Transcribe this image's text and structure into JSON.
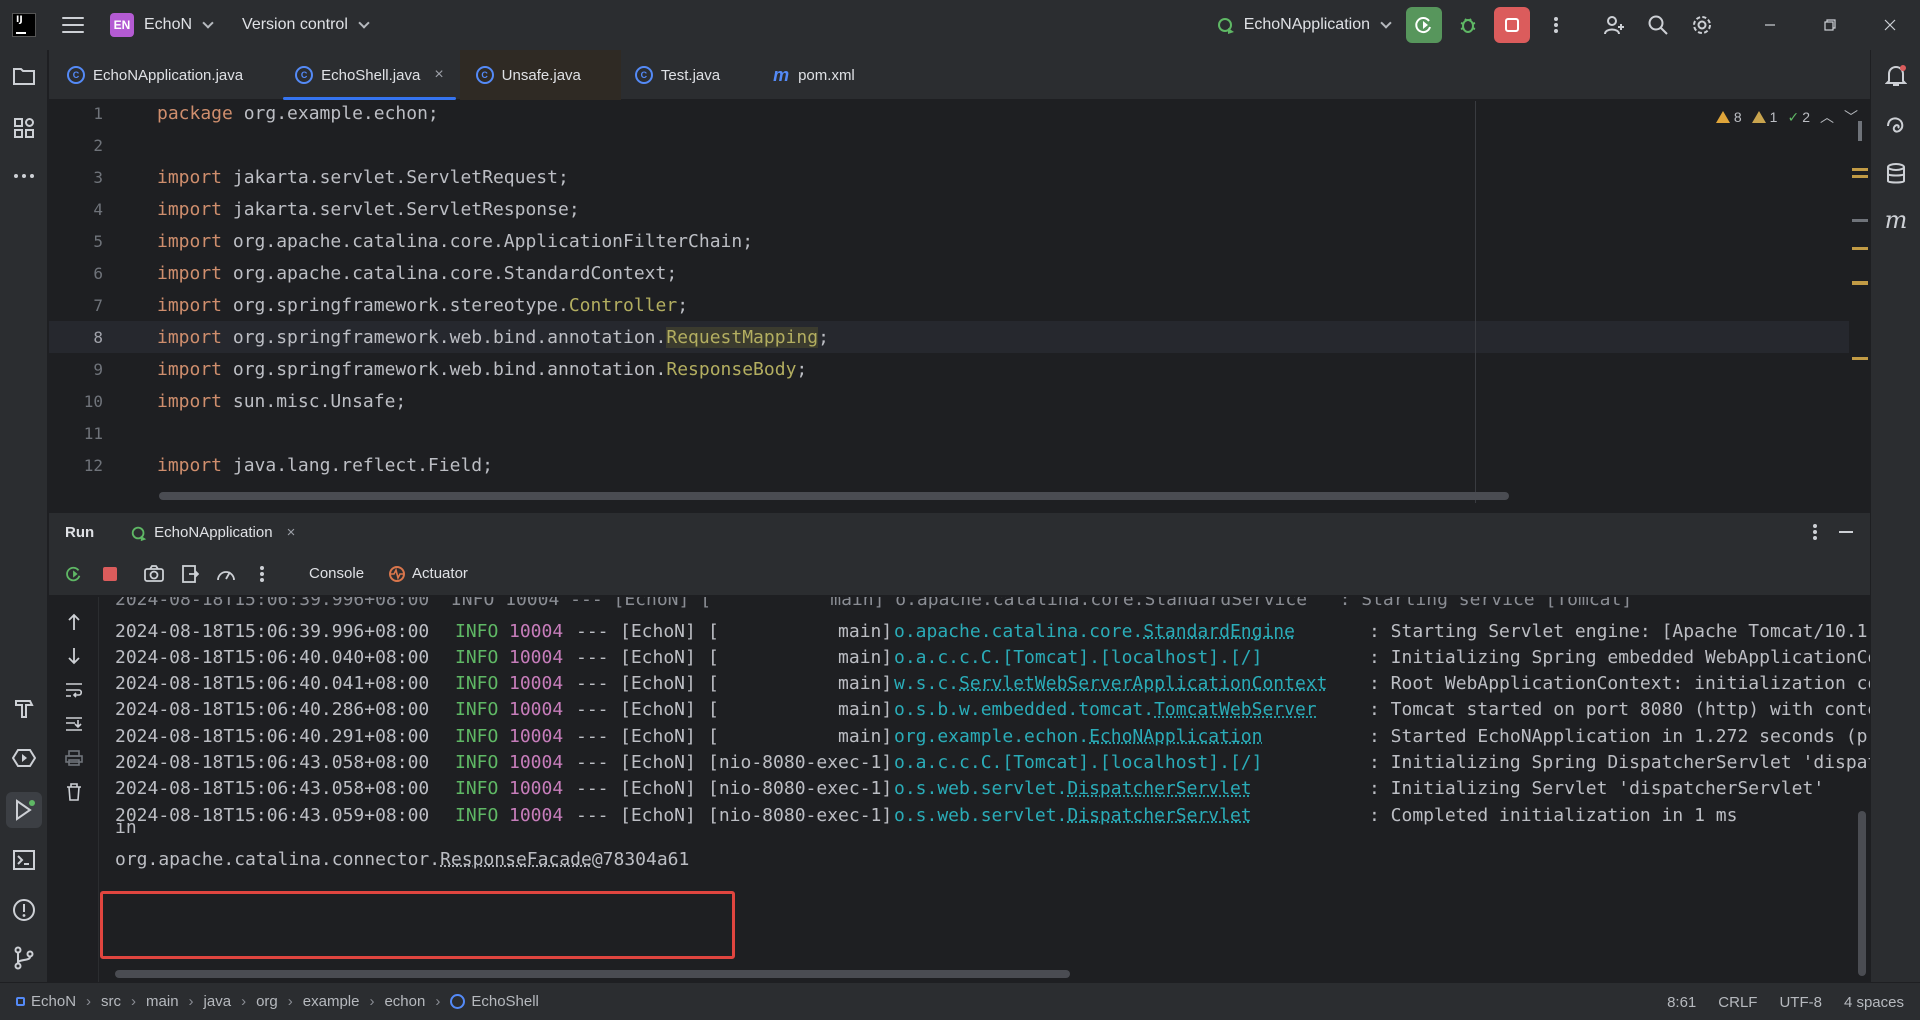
{
  "titlebar": {
    "project_badge": "EN",
    "project_name": "EchoN",
    "version_control": "Version control",
    "run_config": "EchoNApplication"
  },
  "tabs": [
    {
      "label": "EchoNApplication.java"
    },
    {
      "label": "EchoShell.java",
      "close": "×"
    },
    {
      "label": "Unsafe.java"
    },
    {
      "label": "Test.java"
    },
    {
      "label": "pom.xml"
    }
  ],
  "inspections": {
    "warnings": "8",
    "weak": "1",
    "ok": "2"
  },
  "editor": {
    "lines": [
      {
        "n": "1",
        "kw": "package",
        "rest": " org.example.echon;"
      },
      {
        "n": "2"
      },
      {
        "n": "3",
        "kw": "import",
        "rest": " jakarta.servlet.ServletRequest;"
      },
      {
        "n": "4",
        "kw": "import",
        "rest": " jakarta.servlet.ServletResponse;"
      },
      {
        "n": "5",
        "kw": "import",
        "rest": " org.apache.catalina.core.ApplicationFilterChain;"
      },
      {
        "n": "6",
        "kw": "import",
        "rest": " org.apache.catalina.core.StandardContext;"
      },
      {
        "n": "7",
        "kw": "import",
        "rest": " org.springframework.stereotype.",
        "ann": "Controller",
        "tail": ";"
      },
      {
        "n": "8",
        "kw": "import",
        "rest": " org.springframework.web.bind.annotation.",
        "ann": "RequestMapping",
        "tail": ";"
      },
      {
        "n": "9",
        "kw": "import",
        "rest": " org.springframework.web.bind.annotation.",
        "ann": "ResponseBody",
        "tail": ";"
      },
      {
        "n": "10",
        "kw": "import",
        "rest": " sun.misc.Unsafe;"
      },
      {
        "n": "11"
      },
      {
        "n": "12",
        "kw": "import",
        "rest": " java.lang.reflect.Field;"
      }
    ]
  },
  "run": {
    "title": "Run",
    "tab_label": "EchoNApplication",
    "tab_close": "×",
    "console_tab": "Console",
    "actuator_tab": "Actuator"
  },
  "console": {
    "logs": [
      {
        "ts": "2024-08-18T15:06:39.996+08:00",
        "lvl": "INFO",
        "pid": "10004",
        "sep": "---",
        "app": "[EchoN]",
        "thr": "[           main]",
        "lg_pre": "o.apache.catalina.core.",
        "lg_u": "StandardEngine",
        "msg": ": Starting Servlet engine: [Apache Tomcat/10.1."
      },
      {
        "ts": "2024-08-18T15:06:40.040+08:00",
        "lvl": "INFO",
        "pid": "10004",
        "sep": "---",
        "app": "[EchoN]",
        "thr": "[           main]",
        "lg_pre": "o.a.c.c.C.[Tomcat].[localhost].[/]",
        "lg_u": "",
        "msg": ": Initializing Spring embedded WebApplicationCo"
      },
      {
        "ts": "2024-08-18T15:06:40.041+08:00",
        "lvl": "INFO",
        "pid": "10004",
        "sep": "---",
        "app": "[EchoN]",
        "thr": "[           main]",
        "lg_pre": "w.s.c.",
        "lg_u": "ServletWebServerApplicationContext",
        "msg": ": Root WebApplicationContext: initialization co"
      },
      {
        "ts": "2024-08-18T15:06:40.286+08:00",
        "lvl": "INFO",
        "pid": "10004",
        "sep": "---",
        "app": "[EchoN]",
        "thr": "[           main]",
        "lg_pre": "o.s.b.w.embedded.tomcat.",
        "lg_u": "TomcatWebServer",
        "msg": ": Tomcat started on port 8080 (http) with conte"
      },
      {
        "ts": "2024-08-18T15:06:40.291+08:00",
        "lvl": "INFO",
        "pid": "10004",
        "sep": "---",
        "app": "[EchoN]",
        "thr": "[           main]",
        "lg_pre": "org.example.echon.",
        "lg_u": "EchoNApplication",
        "msg": ": Started EchoNApplication in 1.272 seconds (pr"
      },
      {
        "ts": "2024-08-18T15:06:43.058+08:00",
        "lvl": "INFO",
        "pid": "10004",
        "sep": "---",
        "app": "[EchoN]",
        "thr": "[nio-8080-exec-1]",
        "lg_pre": "o.a.c.c.C.[Tomcat].[localhost].[/]",
        "lg_u": "",
        "msg": ": Initializing Spring DispatcherServlet 'dispat"
      },
      {
        "ts": "2024-08-18T15:06:43.058+08:00",
        "lvl": "INFO",
        "pid": "10004",
        "sep": "---",
        "app": "[EchoN]",
        "thr": "[nio-8080-exec-1]",
        "lg_pre": "o.s.web.servlet.",
        "lg_u": "DispatcherServlet",
        "msg": ": Initializing Servlet 'dispatcherServlet'"
      },
      {
        "ts": "2024-08-18T15:06:43.059+08:00",
        "lvl": "INFO",
        "pid": "10004",
        "sep": "---",
        "app": "[EchoN]",
        "thr": "[nio-8080-exec-1]",
        "lg_pre": "o.s.web.servlet.",
        "lg_u": "DispatcherServlet",
        "msg": ": Completed initialization in 1 ms"
      }
    ],
    "partial_top": "2024-08-18T15:06:39.996+08:00  INFO 10004 --- [EchoN] [           main] o.apache.catalina.core.StandardService   : Starting service [Tomcat]",
    "plain_line": "in",
    "output_prefix": "org.apache.catalina.connector.",
    "output_class": "ResponseFacade",
    "output_suffix": "@78304a61"
  },
  "statusbar": {
    "crumbs": [
      "EchoN",
      "src",
      "main",
      "java",
      "org",
      "example",
      "echon",
      "EchoShell"
    ],
    "position": "8:61",
    "line_sep": "CRLF",
    "encoding": "UTF-8",
    "indent": "4 spaces"
  },
  "colors": {
    "accent": "#3574f0",
    "run_green": "#57965c",
    "stop_red": "#db5c5c",
    "highlight_box": "#e0453f"
  }
}
